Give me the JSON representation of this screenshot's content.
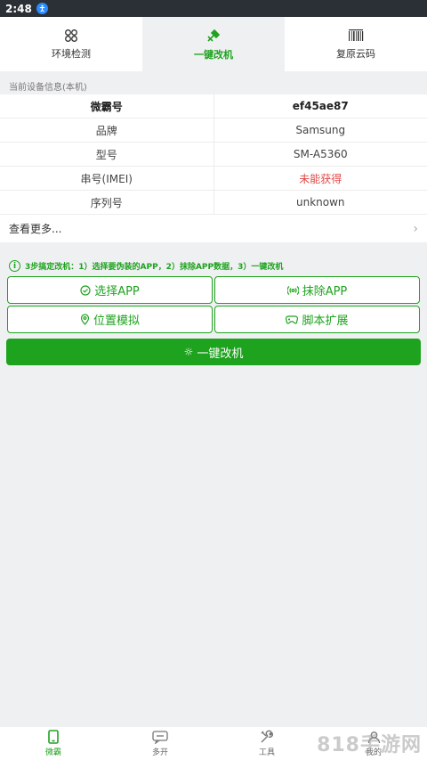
{
  "status": {
    "time": "2:48"
  },
  "tabs": [
    {
      "label": "环境检测",
      "icon": "glasses-icon"
    },
    {
      "label": "一键改机",
      "icon": "magic-wand-icon"
    },
    {
      "label": "复原云码",
      "icon": "barcode-icon"
    }
  ],
  "device": {
    "section_title": "当前设备信息(本机)",
    "header": {
      "key": "微霸号",
      "value": "ef45ae87"
    },
    "rows": [
      {
        "key": "品牌",
        "value": "Samsung"
      },
      {
        "key": "型号",
        "value": "SM-A5360"
      },
      {
        "key": "串号(IMEI)",
        "value": "未能获得"
      },
      {
        "key": "序列号",
        "value": "unknown"
      }
    ],
    "more": "查看更多..."
  },
  "tip": "3步搞定改机：1）选择要伪装的APP，2）抹除APP数据，3）一键改机",
  "actions": {
    "select_app": "选择APP",
    "erase_app": "抹除APP",
    "location": "位置模拟",
    "script": "脚本扩展",
    "one_key": "一键改机"
  },
  "nav": [
    {
      "label": "微霸",
      "icon": "phone-icon"
    },
    {
      "label": "多开",
      "icon": "chat-icon"
    },
    {
      "label": "工具",
      "icon": "tools-icon"
    },
    {
      "label": "我的",
      "icon": "user-icon"
    }
  ],
  "watermark": "818手游网",
  "colors": {
    "accent": "#1ea31e",
    "warning": "#e04848",
    "statusbar": "#2b2f36"
  }
}
